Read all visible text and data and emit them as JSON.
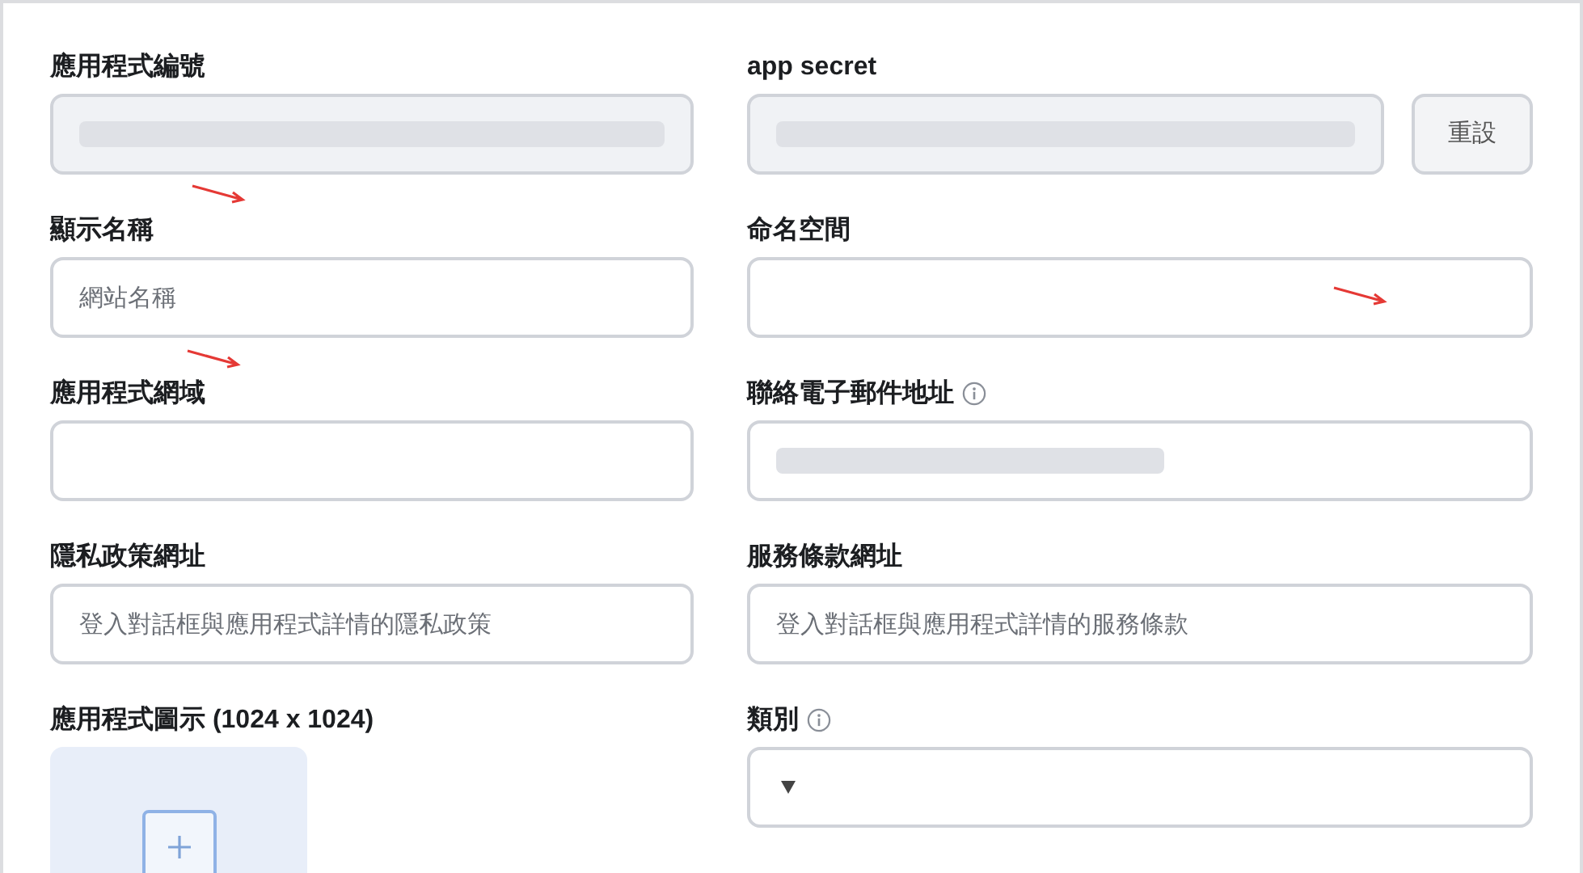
{
  "rows": [
    {
      "left": {
        "label": "應用程式編號",
        "kind": "masked",
        "disabled": true
      },
      "right": {
        "label": "app secret",
        "kind": "masked",
        "disabled": true,
        "button": "重設"
      }
    },
    {
      "left": {
        "label": "顯示名稱",
        "kind": "text",
        "placeholder": "網站名稱"
      },
      "right": {
        "label": "命名空間",
        "kind": "text"
      }
    },
    {
      "left": {
        "label": "應用程式網域",
        "kind": "text"
      },
      "right": {
        "label": "聯絡電子郵件地址",
        "kind": "masked",
        "disabled": false,
        "info": true
      }
    },
    {
      "left": {
        "label": "隱私政策網址",
        "kind": "text",
        "placeholder": "登入對話框與應用程式詳情的隱私政策"
      },
      "right": {
        "label": "服務條款網址",
        "kind": "text",
        "placeholder": "登入對話框與應用程式詳情的服務條款"
      }
    },
    {
      "left": {
        "label": "應用程式圖示 (1024 x 1024)",
        "kind": "upload"
      },
      "right": {
        "label": "類別",
        "kind": "select",
        "info": true
      }
    }
  ]
}
